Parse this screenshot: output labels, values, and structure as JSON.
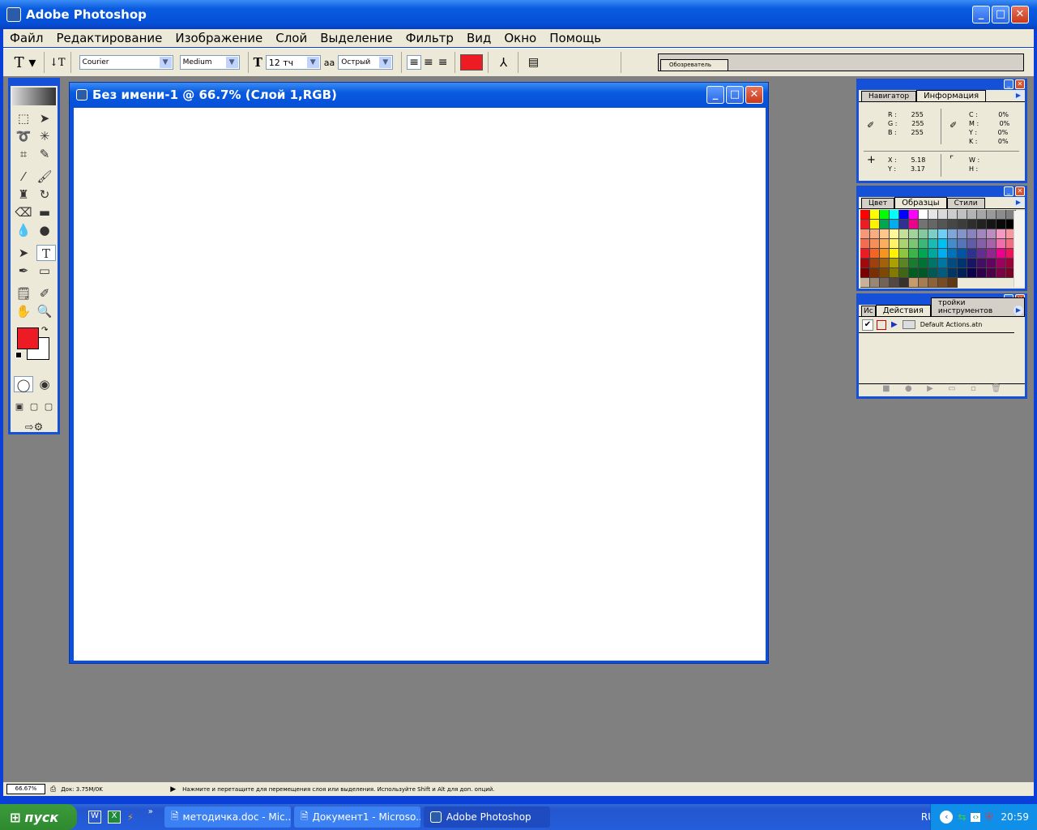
{
  "app": {
    "title": "Adobe Photoshop"
  },
  "menu": [
    "Файл",
    "Редактирование",
    "Изображение",
    "Слой",
    "Выделение",
    "Фильтр",
    "Вид",
    "Окно",
    "Помощь"
  ],
  "options": {
    "font_family": "Courier",
    "font_style": "Medium",
    "font_size": "12 тч",
    "antialias": "Острый",
    "text_color": "#ed1c24",
    "browser_tab": "Обозреватель"
  },
  "document": {
    "title": "Без имени-1 @ 66.7% (Слой 1,RGB)"
  },
  "toolbox": {
    "foreground": "#ed1c24",
    "background": "#ffffff"
  },
  "info_panel": {
    "tabs": [
      "Навигатор",
      "Информация"
    ],
    "rgb": [
      [
        "R",
        "255"
      ],
      [
        "G",
        "255"
      ],
      [
        "B",
        "255"
      ]
    ],
    "cmyk": [
      [
        "C",
        "0%"
      ],
      [
        "M",
        "0%"
      ],
      [
        "Y",
        "0%"
      ],
      [
        "K",
        "0%"
      ]
    ],
    "xy": [
      [
        "X",
        "5.18"
      ],
      [
        "Y",
        "3.17"
      ]
    ],
    "wh": [
      [
        "W",
        ""
      ],
      [
        "H",
        ""
      ]
    ]
  },
  "swatch_panel": {
    "tabs": [
      "Цвет",
      "Образцы",
      "Стили"
    ],
    "colors": [
      "#ff0000",
      "#ffff00",
      "#00ff00",
      "#00ffff",
      "#0000ff",
      "#ff00ff",
      "#ffffff",
      "#e6e6e6",
      "#d9d9d9",
      "#cccccc",
      "#c0c0c0",
      "#b3b3b3",
      "#a6a6a6",
      "#999999",
      "#8c8c8c",
      "#808080",
      "#ed1c24",
      "#fff200",
      "#00a651",
      "#00aeef",
      "#2e3192",
      "#ec008c",
      "#737373",
      "#666666",
      "#555555",
      "#464646",
      "#3c3c3c",
      "#2e2e2e",
      "#222222",
      "#161616",
      "#0a0a0a",
      "#000000",
      "#f7977a",
      "#f9ad81",
      "#fdc68a",
      "#fff79a",
      "#c4df9b",
      "#a3d39c",
      "#82ca9d",
      "#7bcdc8",
      "#6ecff6",
      "#7ea7d8",
      "#8493ca",
      "#8882be",
      "#a187be",
      "#bc8dbf",
      "#f49ac2",
      "#f6989d",
      "#f26c4f",
      "#f68e55",
      "#fbaf5d",
      "#fff467",
      "#acd372",
      "#7cc576",
      "#3bb878",
      "#1abbb4",
      "#00bff3",
      "#438ccb",
      "#5574b9",
      "#605ca8",
      "#855fa8",
      "#a763a8",
      "#f06ea9",
      "#f26d7d",
      "#ed1c24",
      "#f26522",
      "#f7941d",
      "#fff200",
      "#8dc73f",
      "#39b54a",
      "#00a651",
      "#00a99d",
      "#00aeef",
      "#0072bc",
      "#0054a6",
      "#2e3192",
      "#662d91",
      "#92278f",
      "#ec008c",
      "#ed145b",
      "#9e0b0f",
      "#a0410d",
      "#a36209",
      "#aba000",
      "#598527",
      "#1a7b30",
      "#007236",
      "#00746b",
      "#0076a3",
      "#004b80",
      "#003471",
      "#1b1464",
      "#440e62",
      "#630460",
      "#9e005d",
      "#9e0039",
      "#790000",
      "#7b2e00",
      "#7d4900",
      "#827b00",
      "#406618",
      "#005e20",
      "#005826",
      "#005952",
      "#005b7f",
      "#003663",
      "#002157",
      "#0d004c",
      "#32004b",
      "#4b0049",
      "#7b0046",
      "#7a0026",
      "#c7b299",
      "#998675",
      "#736357",
      "#534741",
      "#37302d",
      "#c69c6d",
      "#a67c52",
      "#8c6239",
      "#754c24",
      "#603913"
    ]
  },
  "actions_panel": {
    "tabs": [
      "Ис",
      "Действия",
      "тройки инструментов"
    ],
    "item": "Default Actions.atn"
  },
  "status": {
    "zoom": "66.67%",
    "doc": "Док: 3.75M/0K",
    "hint": "Нажмите и перетащите для перемещения слоя или выделения. Используйте Shift и Alt для доп. опций."
  },
  "taskbar": {
    "start": "пуск",
    "tasks": [
      "методичка.doc - Mic...",
      "Документ1 - Microso...",
      "Adobe Photoshop"
    ],
    "lang": "RU",
    "time": "20:59"
  }
}
